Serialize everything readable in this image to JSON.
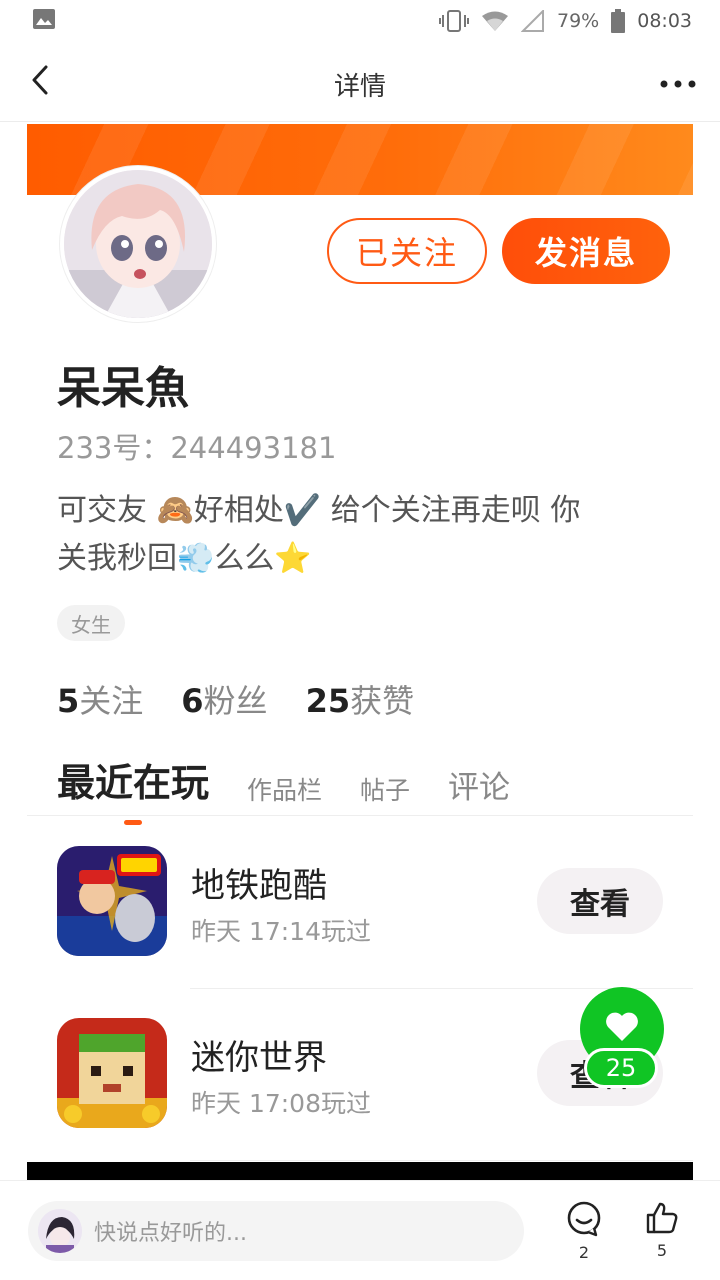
{
  "status_bar": {
    "battery": "79%",
    "time": "08:03"
  },
  "nav": {
    "title": "详情"
  },
  "profile": {
    "follow_label": "已关注",
    "message_label": "发消息",
    "username": "呆呆魚",
    "id_label": "233号：",
    "id_value": "244493181",
    "bio_line1": "可交友 🙈好相处✔️ 给个关注再走呗 你",
    "bio_line2": "关我秒回💨么么⭐",
    "gender_tag": "女生"
  },
  "stats": [
    {
      "count": "5",
      "label": "关注"
    },
    {
      "count": "6",
      "label": "粉丝"
    },
    {
      "count": "25",
      "label": "获赞"
    }
  ],
  "tabs": [
    "最近在玩",
    "作品栏",
    "帖子",
    "评论"
  ],
  "games": [
    {
      "name": "地铁跑酷",
      "time": "昨天 17:14玩过",
      "button": "查看"
    },
    {
      "name": "迷你世界",
      "time": "昨天 17:08玩过",
      "button": "查看"
    }
  ],
  "float_like": {
    "count": "25"
  },
  "bottom_bar": {
    "placeholder": "快说点好听的...",
    "comment_count": "2",
    "like_count": "5"
  },
  "colors": {
    "accent": "#ff5a14",
    "like_green": "#10c524"
  },
  "icons": [
    "image-icon",
    "vibrate-icon",
    "wifi-icon",
    "signal-icon",
    "battery-icon",
    "back-arrow-icon",
    "more-icon",
    "heart-icon",
    "comment-icon",
    "thumb-up-icon"
  ]
}
